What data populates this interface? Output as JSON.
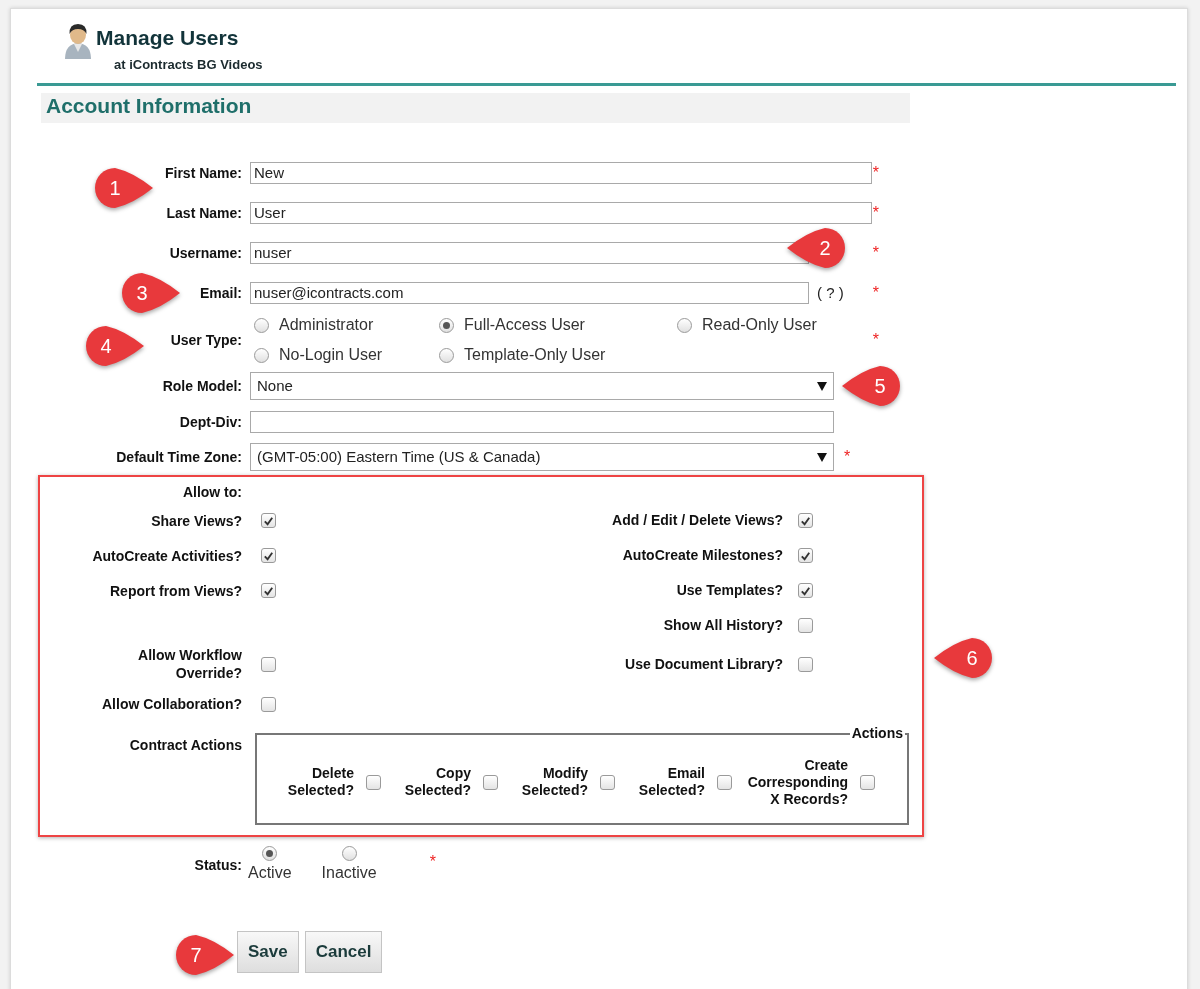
{
  "header": {
    "title": "Manage Users",
    "subtitle": "at iContracts BG Videos"
  },
  "section_title": "Account Information",
  "fields": [
    {
      "kind": "text",
      "label": "First Name:",
      "value": "New",
      "required_mark": "*"
    },
    {
      "kind": "text",
      "label": "Last Name:",
      "value": "User",
      "required_mark": "*"
    },
    {
      "kind": "text",
      "label": "Username:",
      "value": "nuser",
      "required_mark": "*"
    },
    {
      "kind": "text",
      "label": "Email:",
      "value": "nuser@icontracts.com",
      "hint": "( ? )",
      "required_mark": "*"
    },
    {
      "kind": "radio",
      "label": "User Type:",
      "required_mark": "*",
      "options": [
        {
          "label": "Administrator",
          "selected": false
        },
        {
          "label": "Full-Access User",
          "selected": true
        },
        {
          "label": "Read-Only User",
          "selected": false
        },
        {
          "label": "No-Login User",
          "selected": false
        },
        {
          "label": "Template-Only User",
          "selected": false
        }
      ]
    },
    {
      "kind": "select",
      "label": "Role Model:",
      "value": "None"
    },
    {
      "kind": "text",
      "label": "Dept-Div:"
    },
    {
      "kind": "select",
      "label": "Default Time Zone:",
      "value": "(GMT-05:00) Eastern Time (US & Canada)",
      "required_mark": "*"
    }
  ],
  "permissions": {
    "heading": "Allow to:",
    "rows": [
      {
        "left": {
          "label": "Share Views?",
          "checked": true
        },
        "right": {
          "label": "Add / Edit / Delete Views?",
          "checked": true
        }
      },
      {
        "left": {
          "label": "AutoCreate Activities?",
          "checked": true
        },
        "right": {
          "label": "AutoCreate Milestones?",
          "checked": true
        }
      },
      {
        "left": {
          "label": "Report from Views?",
          "checked": true
        },
        "right": {
          "label": "Use Templates?",
          "checked": true
        }
      },
      {
        "right": {
          "label": "Show All History?",
          "checked": false
        }
      },
      {
        "left": {
          "label": "Allow Workflow Override?",
          "checked": false
        },
        "right": {
          "label": "Use Document Library?",
          "checked": false
        }
      },
      {
        "left": {
          "label": "Allow Collaboration?",
          "checked": false
        }
      }
    ],
    "contract_actions": {
      "label": "Contract Actions",
      "legend": "Actions",
      "items": [
        {
          "label": "Delete Selected?",
          "checked": false
        },
        {
          "label": "Copy Selected?",
          "checked": false
        },
        {
          "label": "Modify Selected?",
          "checked": false
        },
        {
          "label": "Email Selected?",
          "checked": false
        },
        {
          "label": "Create Corresponding X Records?",
          "checked": false
        }
      ]
    }
  },
  "status": {
    "label": "Status:",
    "required_mark": "*",
    "options": [
      {
        "label": "Active",
        "selected": true
      },
      {
        "label": "Inactive",
        "selected": false
      }
    ]
  },
  "buttons": [
    "Save",
    "Cancel"
  ],
  "callouts": [
    {
      "number": "1",
      "points_left": false
    },
    {
      "number": "2",
      "points_left": true
    },
    {
      "number": "3",
      "points_left": false
    },
    {
      "number": "4",
      "points_left": false
    },
    {
      "number": "5",
      "points_left": true
    },
    {
      "number": "6",
      "points_left": true
    },
    {
      "number": "7",
      "points_left": false
    }
  ]
}
